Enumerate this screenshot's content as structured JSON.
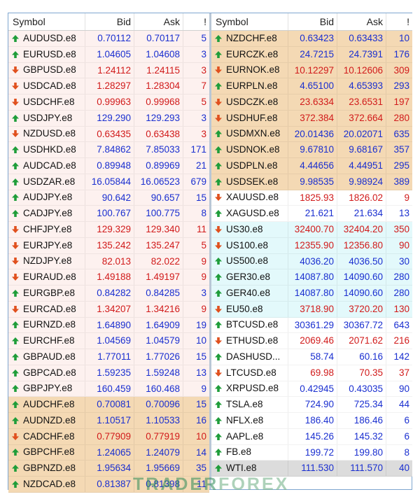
{
  "columns": {
    "symbol": "Symbol",
    "bid": "Bid",
    "ask": "Ask",
    "spread": "!"
  },
  "left": [
    {
      "symbol": "AUDUSD.e8",
      "bid": "0.70112",
      "ask": "0.70117",
      "spread": "5",
      "dir": "up",
      "bg": "pink"
    },
    {
      "symbol": "EURUSD.e8",
      "bid": "1.04605",
      "ask": "1.04608",
      "spread": "3",
      "dir": "up",
      "bg": "pink"
    },
    {
      "symbol": "GBPUSD.e8",
      "bid": "1.24112",
      "ask": "1.24115",
      "spread": "3",
      "dir": "down",
      "bg": "pink"
    },
    {
      "symbol": "USDCAD.e8",
      "bid": "1.28297",
      "ask": "1.28304",
      "spread": "7",
      "dir": "down",
      "bg": "pink"
    },
    {
      "symbol": "USDCHF.e8",
      "bid": "0.99963",
      "ask": "0.99968",
      "spread": "5",
      "dir": "down",
      "bg": "pink"
    },
    {
      "symbol": "USDJPY.e8",
      "bid": "129.290",
      "ask": "129.293",
      "spread": "3",
      "dir": "up",
      "bg": "pink"
    },
    {
      "symbol": "NZDUSD.e8",
      "bid": "0.63435",
      "ask": "0.63438",
      "spread": "3",
      "dir": "down",
      "bg": "pink"
    },
    {
      "symbol": "USDHKD.e8",
      "bid": "7.84862",
      "ask": "7.85033",
      "spread": "171",
      "dir": "up",
      "bg": "pink"
    },
    {
      "symbol": "AUDCAD.e8",
      "bid": "0.89948",
      "ask": "0.89969",
      "spread": "21",
      "dir": "up",
      "bg": "pink"
    },
    {
      "symbol": "USDZAR.e8",
      "bid": "16.05844",
      "ask": "16.06523",
      "spread": "679",
      "dir": "up",
      "bg": "pink"
    },
    {
      "symbol": "AUDJPY.e8",
      "bid": "90.642",
      "ask": "90.657",
      "spread": "15",
      "dir": "up",
      "bg": "pink"
    },
    {
      "symbol": "CADJPY.e8",
      "bid": "100.767",
      "ask": "100.775",
      "spread": "8",
      "dir": "up",
      "bg": "pink"
    },
    {
      "symbol": "CHFJPY.e8",
      "bid": "129.329",
      "ask": "129.340",
      "spread": "11",
      "dir": "down",
      "bg": "pink"
    },
    {
      "symbol": "EURJPY.e8",
      "bid": "135.242",
      "ask": "135.247",
      "spread": "5",
      "dir": "down",
      "bg": "pink"
    },
    {
      "symbol": "NZDJPY.e8",
      "bid": "82.013",
      "ask": "82.022",
      "spread": "9",
      "dir": "down",
      "bg": "pink"
    },
    {
      "symbol": "EURAUD.e8",
      "bid": "1.49188",
      "ask": "1.49197",
      "spread": "9",
      "dir": "down",
      "bg": "pink"
    },
    {
      "symbol": "EURGBP.e8",
      "bid": "0.84282",
      "ask": "0.84285",
      "spread": "3",
      "dir": "up",
      "bg": "pink"
    },
    {
      "symbol": "EURCAD.e8",
      "bid": "1.34207",
      "ask": "1.34216",
      "spread": "9",
      "dir": "down",
      "bg": "pink"
    },
    {
      "symbol": "EURNZD.e8",
      "bid": "1.64890",
      "ask": "1.64909",
      "spread": "19",
      "dir": "up",
      "bg": "pink"
    },
    {
      "symbol": "EURCHF.e8",
      "bid": "1.04569",
      "ask": "1.04579",
      "spread": "10",
      "dir": "up",
      "bg": "pink"
    },
    {
      "symbol": "GBPAUD.e8",
      "bid": "1.77011",
      "ask": "1.77026",
      "spread": "15",
      "dir": "up",
      "bg": "pink"
    },
    {
      "symbol": "GBPCAD.e8",
      "bid": "1.59235",
      "ask": "1.59248",
      "spread": "13",
      "dir": "up",
      "bg": "pink"
    },
    {
      "symbol": "GBPJPY.e8",
      "bid": "160.459",
      "ask": "160.468",
      "spread": "9",
      "dir": "up",
      "bg": "pink"
    },
    {
      "symbol": "AUDCHF.e8",
      "bid": "0.70081",
      "ask": "0.70096",
      "spread": "15",
      "dir": "up",
      "bg": "tan"
    },
    {
      "symbol": "AUDNZD.e8",
      "bid": "1.10517",
      "ask": "1.10533",
      "spread": "16",
      "dir": "up",
      "bg": "tan"
    },
    {
      "symbol": "CADCHF.e8",
      "bid": "0.77909",
      "ask": "0.77919",
      "spread": "10",
      "dir": "down",
      "bg": "tan"
    },
    {
      "symbol": "GBPCHF.e8",
      "bid": "1.24065",
      "ask": "1.24079",
      "spread": "14",
      "dir": "up",
      "bg": "tan"
    },
    {
      "symbol": "GBPNZD.e8",
      "bid": "1.95634",
      "ask": "1.95669",
      "spread": "35",
      "dir": "up",
      "bg": "tan"
    },
    {
      "symbol": "NZDCAD.e8",
      "bid": "0.81387",
      "ask": "0.81398",
      "spread": "11",
      "dir": "up",
      "bg": "tan"
    }
  ],
  "right": [
    {
      "symbol": "NZDCHF.e8",
      "bid": "0.63423",
      "ask": "0.63433",
      "spread": "10",
      "dir": "up",
      "bg": "tan"
    },
    {
      "symbol": "EURCZK.e8",
      "bid": "24.7215",
      "ask": "24.7391",
      "spread": "176",
      "dir": "up",
      "bg": "tan"
    },
    {
      "symbol": "EURNOK.e8",
      "bid": "10.12297",
      "ask": "10.12606",
      "spread": "309",
      "dir": "down",
      "bg": "tan"
    },
    {
      "symbol": "EURPLN.e8",
      "bid": "4.65100",
      "ask": "4.65393",
      "spread": "293",
      "dir": "up",
      "bg": "tan"
    },
    {
      "symbol": "USDCZK.e8",
      "bid": "23.6334",
      "ask": "23.6531",
      "spread": "197",
      "dir": "down",
      "bg": "tan"
    },
    {
      "symbol": "USDHUF.e8",
      "bid": "372.384",
      "ask": "372.664",
      "spread": "280",
      "dir": "down",
      "bg": "tan"
    },
    {
      "symbol": "USDMXN.e8",
      "bid": "20.01436",
      "ask": "20.02071",
      "spread": "635",
      "dir": "up",
      "bg": "tan"
    },
    {
      "symbol": "USDNOK.e8",
      "bid": "9.67810",
      "ask": "9.68167",
      "spread": "357",
      "dir": "up",
      "bg": "tan"
    },
    {
      "symbol": "USDPLN.e8",
      "bid": "4.44656",
      "ask": "4.44951",
      "spread": "295",
      "dir": "up",
      "bg": "tan"
    },
    {
      "symbol": "USDSEK.e8",
      "bid": "9.98535",
      "ask": "9.98924",
      "spread": "389",
      "dir": "up",
      "bg": "tan"
    },
    {
      "symbol": "XAUUSD.e8",
      "bid": "1825.93",
      "ask": "1826.02",
      "spread": "9",
      "dir": "down",
      "bg": "white"
    },
    {
      "symbol": "XAGUSD.e8",
      "bid": "21.621",
      "ask": "21.634",
      "spread": "13",
      "dir": "up",
      "bg": "white"
    },
    {
      "symbol": "US30.e8",
      "bid": "32400.70",
      "ask": "32404.20",
      "spread": "350",
      "dir": "down",
      "bg": "cyan"
    },
    {
      "symbol": "US100.e8",
      "bid": "12355.90",
      "ask": "12356.80",
      "spread": "90",
      "dir": "down",
      "bg": "cyan"
    },
    {
      "symbol": "US500.e8",
      "bid": "4036.20",
      "ask": "4036.50",
      "spread": "30",
      "dir": "up",
      "bg": "cyan"
    },
    {
      "symbol": "GER30.e8",
      "bid": "14087.80",
      "ask": "14090.60",
      "spread": "280",
      "dir": "up",
      "bg": "cyan"
    },
    {
      "symbol": "GER40.e8",
      "bid": "14087.80",
      "ask": "14090.60",
      "spread": "280",
      "dir": "up",
      "bg": "cyan"
    },
    {
      "symbol": "EU50.e8",
      "bid": "3718.90",
      "ask": "3720.20",
      "spread": "130",
      "dir": "down",
      "bg": "cyan"
    },
    {
      "symbol": "BTCUSD.e8",
      "bid": "30361.29",
      "ask": "30367.72",
      "spread": "643",
      "dir": "up",
      "bg": "white"
    },
    {
      "symbol": "ETHUSD.e8",
      "bid": "2069.46",
      "ask": "2071.62",
      "spread": "216",
      "dir": "down",
      "bg": "white"
    },
    {
      "symbol": "DASHUSD...",
      "bid": "58.74",
      "ask": "60.16",
      "spread": "142",
      "dir": "up",
      "bg": "white"
    },
    {
      "symbol": "LTCUSD.e8",
      "bid": "69.98",
      "ask": "70.35",
      "spread": "37",
      "dir": "down",
      "bg": "white"
    },
    {
      "symbol": "XRPUSD.e8",
      "bid": "0.42945",
      "ask": "0.43035",
      "spread": "90",
      "dir": "up",
      "bg": "white"
    },
    {
      "symbol": "TSLA.e8",
      "bid": "724.90",
      "ask": "725.34",
      "spread": "44",
      "dir": "up",
      "bg": "white"
    },
    {
      "symbol": "NFLX.e8",
      "bid": "186.40",
      "ask": "186.46",
      "spread": "6",
      "dir": "up",
      "bg": "white"
    },
    {
      "symbol": "AAPL.e8",
      "bid": "145.26",
      "ask": "145.32",
      "spread": "6",
      "dir": "up",
      "bg": "white"
    },
    {
      "symbol": "FB.e8",
      "bid": "199.72",
      "ask": "199.80",
      "spread": "8",
      "dir": "up",
      "bg": "white"
    },
    {
      "symbol": "WTI.e8",
      "bid": "111.530",
      "ask": "111.570",
      "spread": "40",
      "dir": "up",
      "bg": "gray"
    }
  ],
  "watermark": {
    "part1": "TRADER",
    "part2": "FOREX"
  },
  "colors": {
    "up": "#1a2fd0",
    "down": "#d11a1a",
    "up_arrow": "#1f9d3a",
    "down_arrow": "#e0501e"
  }
}
